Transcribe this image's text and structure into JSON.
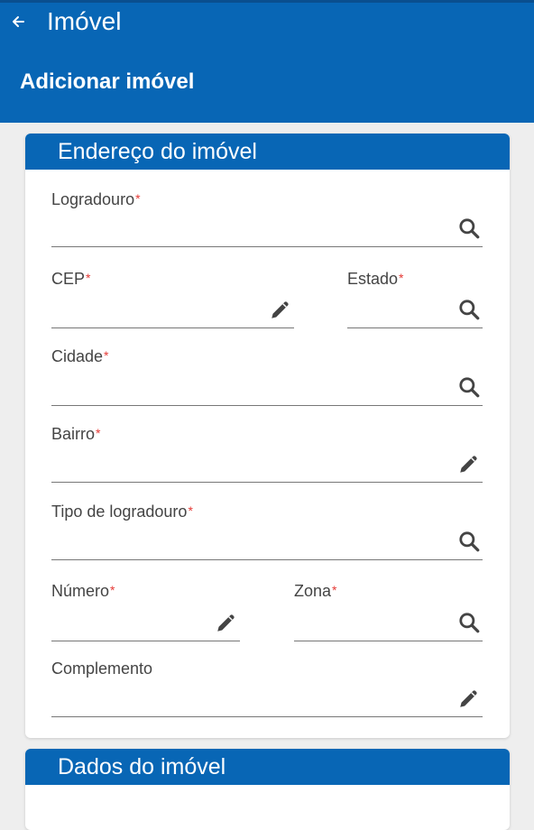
{
  "appbar": {
    "title": "Imóvel",
    "subtitle": "Adicionar imóvel",
    "color": "#0866b5"
  },
  "address_section": {
    "title": "Endereço do imóvel",
    "required_marker": "*",
    "fields": {
      "logradouro": {
        "label": "Logradouro",
        "icon": "search-icon"
      },
      "cep": {
        "label": "CEP",
        "icon": "pencil-icon"
      },
      "estado": {
        "label": "Estado",
        "icon": "search-icon"
      },
      "cidade": {
        "label": "Cidade",
        "icon": "search-icon"
      },
      "bairro": {
        "label": "Bairro",
        "icon": "pencil-icon"
      },
      "tipo_logradouro": {
        "label": "Tipo de logradouro",
        "icon": "search-icon"
      },
      "numero": {
        "label": "Número",
        "icon": "pencil-icon"
      },
      "zona": {
        "label": "Zona",
        "icon": "search-icon"
      },
      "complemento": {
        "label": "Complemento",
        "icon": "pencil-icon"
      }
    }
  },
  "property_section": {
    "title": "Dados do imóvel"
  }
}
